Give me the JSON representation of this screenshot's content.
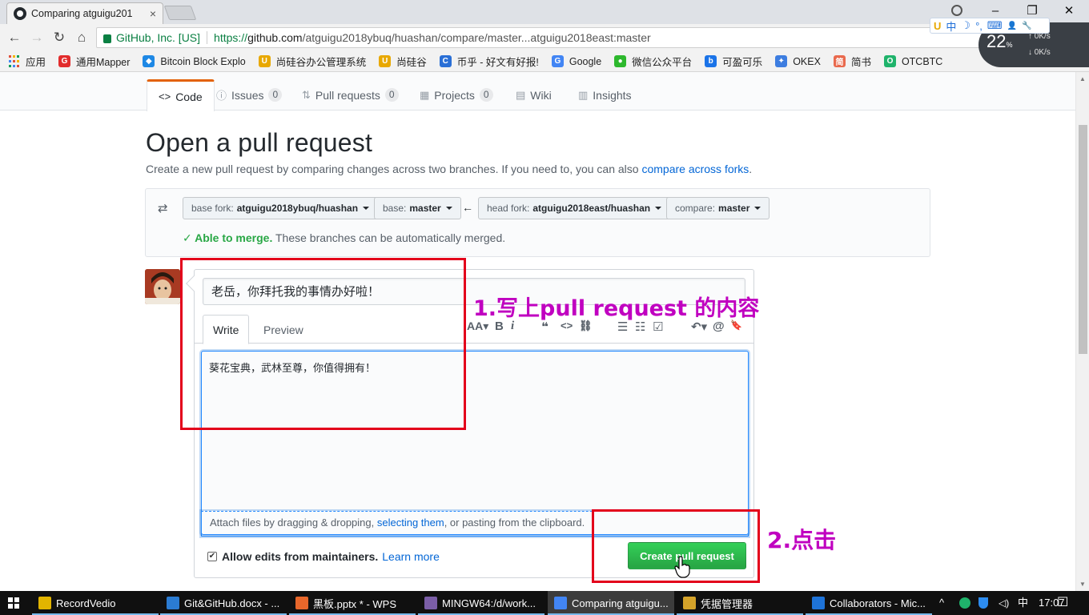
{
  "browser": {
    "tab_title": "Comparing atguigu201",
    "close_glyph": "×",
    "window_controls": [
      "–",
      "❐",
      "✕"
    ],
    "nav": {
      "back": "←",
      "forward": "→",
      "reload": "↻",
      "home": "⌂"
    },
    "secure_label": "GitHub, Inc. [US]",
    "url_prefix": "https://",
    "url_host": "github.com",
    "url_path": "/atguigu2018ybuq/huashan/compare/master...atguigu2018east:master",
    "bookmarks": [
      {
        "label": "应用",
        "color": "#e0503c",
        "icon": "apps-grid-icon"
      },
      {
        "label": "通用Mapper",
        "color": "#e22c2c",
        "icon": "G"
      },
      {
        "label": "Bitcoin Block Explo",
        "color": "#1e88e5",
        "icon": "◆"
      },
      {
        "label": "尚硅谷办公管理系统",
        "color": "#e8a800",
        "icon": "U"
      },
      {
        "label": "尚硅谷",
        "color": "#e8a800",
        "icon": "U"
      },
      {
        "label": "币乎 - 好文有好报!",
        "color": "#2a6fd6",
        "icon": "C"
      },
      {
        "label": "Google",
        "color": "#4285f4",
        "icon": "G"
      },
      {
        "label": "微信公众平台",
        "color": "#2db82d",
        "icon": "●"
      },
      {
        "label": "可盈可乐",
        "color": "#1a73e8",
        "icon": "b"
      },
      {
        "label": "OKEX",
        "color": "#3d7de0",
        "icon": "✦"
      },
      {
        "label": "简书",
        "color": "#e9694d",
        "icon": "简"
      },
      {
        "label": "OTCBTC",
        "color": "#1fb36b",
        "icon": "O"
      }
    ],
    "ime": {
      "lang": "中",
      "moon": "☽",
      "punct": "°,",
      "keyboard": "⌨",
      "user": "👤",
      "wrench": "🔧"
    },
    "speed": {
      "percent": "22",
      "percent_sign": "%",
      "up": "0K/s",
      "down": "0K/s"
    }
  },
  "reponav": {
    "tabs": [
      {
        "label": "Code",
        "icon": "<>",
        "count": null
      },
      {
        "label": "Issues",
        "icon": "ⓘ",
        "count": "0"
      },
      {
        "label": "Pull requests",
        "icon": "⇅",
        "count": "0"
      },
      {
        "label": "Projects",
        "icon": "▦",
        "count": "0"
      },
      {
        "label": "Wiki",
        "icon": "▤",
        "count": null
      },
      {
        "label": "Insights",
        "icon": "▥",
        "count": null
      }
    ]
  },
  "page": {
    "title": "Open a pull request",
    "description": "Create a new pull request by comparing changes across two branches. If you need to, you can also ",
    "description_link": "compare across forks",
    "description_end": "."
  },
  "range": {
    "base_fork_label": "base fork:",
    "base_fork_value": "atguigu2018ybuq/huashan",
    "base_label": "base:",
    "base_value": "master",
    "head_fork_label": "head fork:",
    "head_fork_value": "atguigu2018east/huashan",
    "compare_label": "compare:",
    "compare_value": "master",
    "arrow": "←",
    "compare_icon": "⇄",
    "merge_ok": "✓ Able to merge.",
    "merge_text": " These branches can be automatically merged."
  },
  "form": {
    "title_value": "老岳，你拜托我的事情办好啦！",
    "tab_write": "Write",
    "tab_preview": "Preview",
    "toolbar": {
      "heading": "AA▾",
      "bold": "B",
      "italic": "i",
      "quote": "❝",
      "code": "<>",
      "link": "⛓",
      "ul": "☰",
      "ol": "☷",
      "task": "☑",
      "reply": "↶▾",
      "mention": "@",
      "bookmark": "🔖"
    },
    "body_value": "葵花宝典，武林至尊，你值得拥有！",
    "attach_pre": "Attach files by dragging & dropping, ",
    "attach_link": "selecting them",
    "attach_post": ", or pasting from the clipboard.",
    "allow_edits": "Allow edits from maintainers.",
    "learn_more": "Learn more",
    "allow_checked_glyph": "✔",
    "create_button": "Create pull request"
  },
  "annotations": {
    "step1": "1.写上pull request 的内容",
    "step2": "2.点击",
    "color": "#c000c0",
    "box_color": "#e3001b"
  },
  "taskbar": {
    "items": [
      {
        "label": "RecordVedio",
        "color": "#e2b400",
        "active": false
      },
      {
        "label": "Git&GitHub.docx - ...",
        "color": "#2b7cd3",
        "active": false
      },
      {
        "label": "黑板.pptx * - WPS",
        "color": "#e8672b",
        "active": false
      },
      {
        "label": "MINGW64:/d/work...",
        "color": "#7b5ea7",
        "active": false
      },
      {
        "label": "Comparing atguigu...",
        "color": "#4285f4",
        "active": true
      },
      {
        "label": "凭据管理器",
        "color": "#d4a32a",
        "active": false
      },
      {
        "label": "Collaborators - Mic...",
        "color": "#1e73d8",
        "active": false
      }
    ],
    "tray_chevron": "^",
    "ime": "中",
    "time": "17:07",
    "notify": "☐"
  }
}
